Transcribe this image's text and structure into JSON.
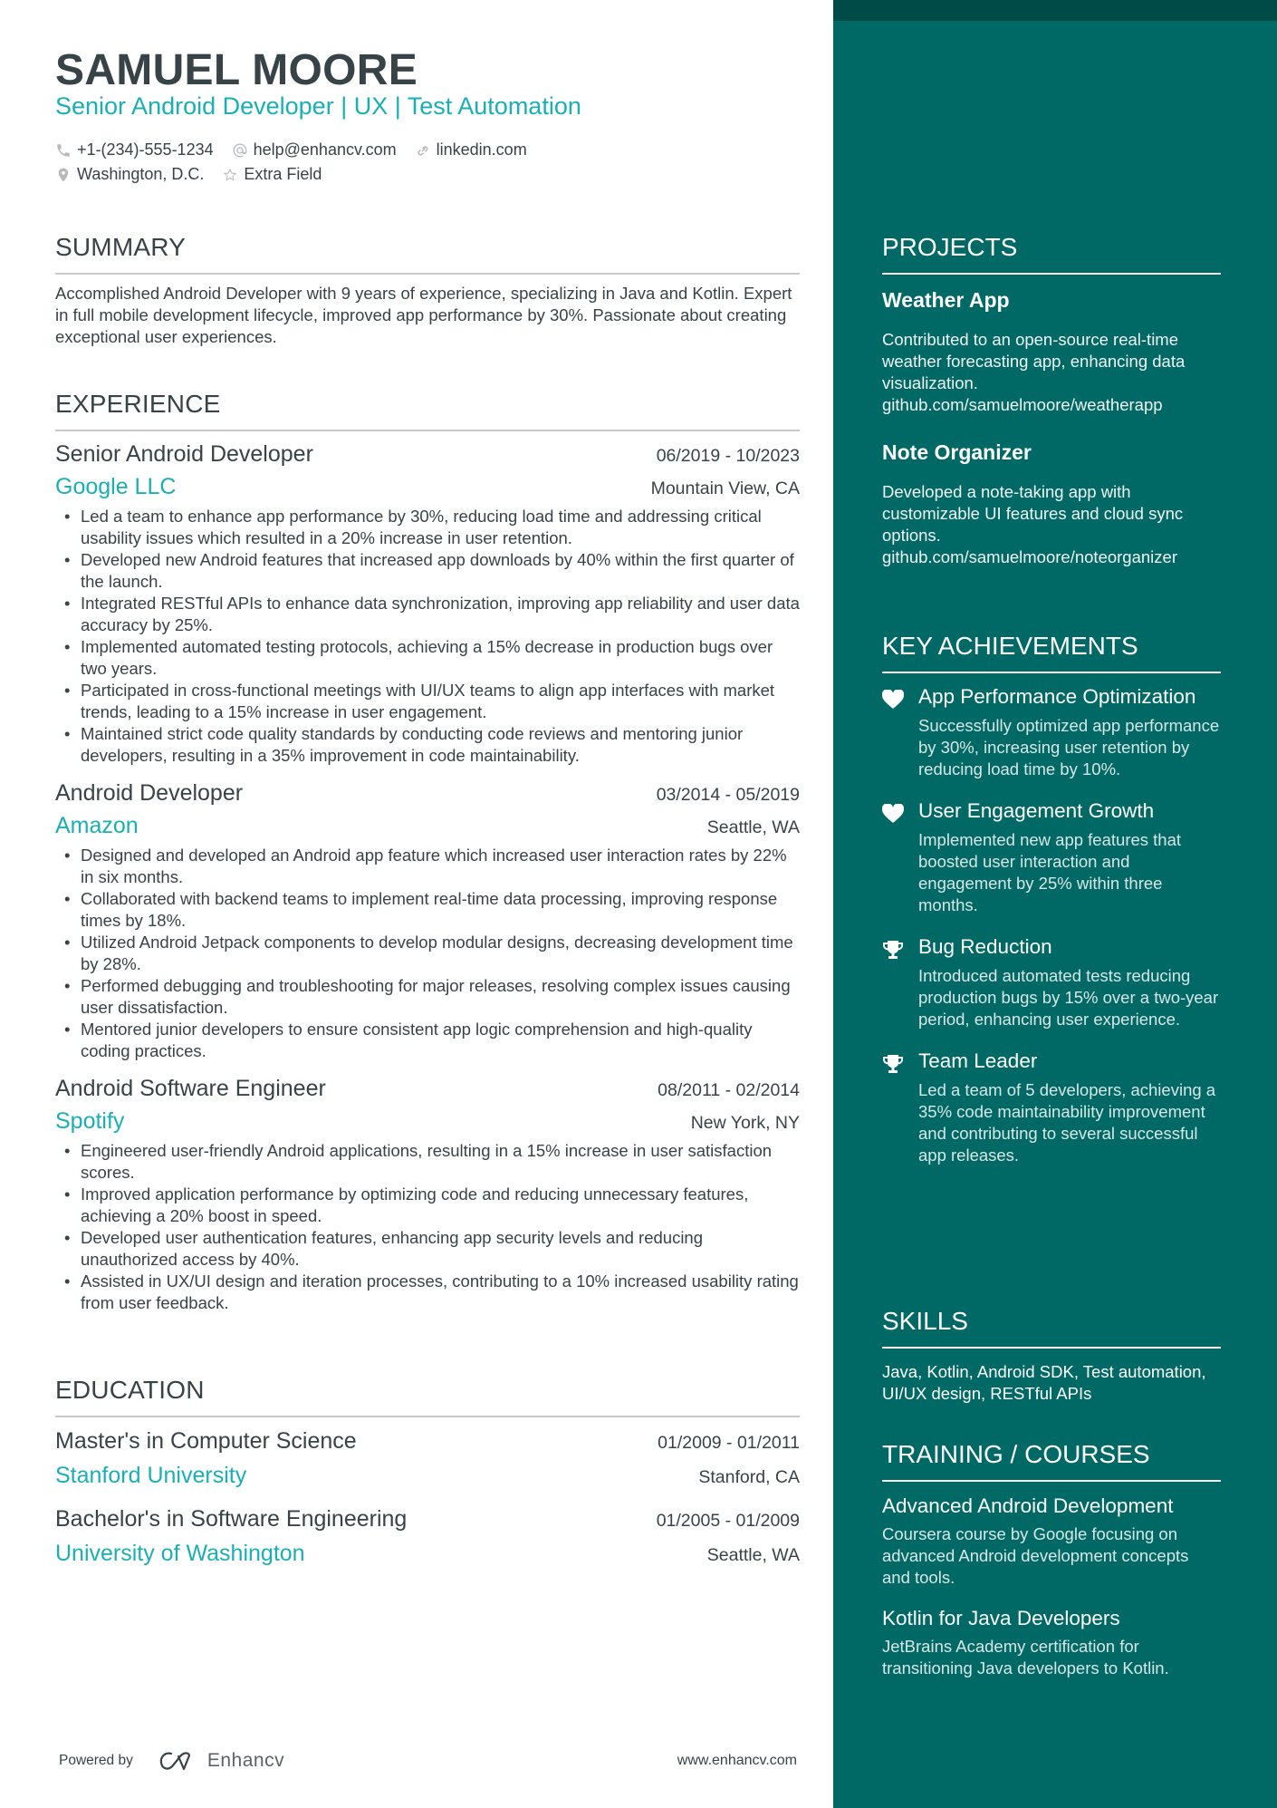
{
  "header": {
    "name": "SAMUEL MOORE",
    "headline": "Senior Android Developer | UX | Test Automation",
    "contacts": [
      {
        "icon": "phone-icon",
        "text": "+1-(234)-555-1234"
      },
      {
        "icon": "at-icon",
        "text": "help@enhancv.com"
      },
      {
        "icon": "link-icon",
        "text": "linkedin.com"
      },
      {
        "icon": "location-pin-icon",
        "text": "Washington, D.C."
      },
      {
        "icon": "star-icon",
        "text": "Extra Field"
      }
    ]
  },
  "summary": {
    "title": "SUMMARY",
    "text": "Accomplished Android Developer with 9 years of experience, specializing in Java and Kotlin. Expert in full mobile development lifecycle, improved app performance by 30%. Passionate about creating exceptional user experiences."
  },
  "experience": {
    "title": "EXPERIENCE",
    "jobs": [
      {
        "title": "Senior Android Developer",
        "dates": "06/2019 - 10/2023",
        "company": "Google LLC",
        "location": "Mountain View, CA",
        "bullets": [
          "Led a team to enhance app performance by 30%, reducing load time and addressing critical usability issues which resulted in a 20% increase in user retention.",
          "Developed new Android features that increased app downloads by 40% within the first quarter of the launch.",
          "Integrated RESTful APIs to enhance data synchronization, improving app reliability and user data accuracy by 25%.",
          "Implemented automated testing protocols, achieving a 15% decrease in production bugs over two years.",
          "Participated in cross-functional meetings with UI/UX teams to align app interfaces with market trends, leading to a 15% increase in user engagement.",
          "Maintained strict code quality standards by conducting code reviews and mentoring junior developers, resulting in a 35% improvement in code maintainability."
        ]
      },
      {
        "title": "Android Developer",
        "dates": "03/2014 - 05/2019",
        "company": "Amazon",
        "location": "Seattle, WA",
        "bullets": [
          "Designed and developed an Android app feature which increased user interaction rates by 22% in six months.",
          "Collaborated with backend teams to implement real-time data processing, improving response times by 18%.",
          "Utilized Android Jetpack components to develop modular designs, decreasing development time by 28%.",
          "Performed debugging and troubleshooting for major releases, resolving complex issues causing user dissatisfaction.",
          "Mentored junior developers to ensure consistent app logic comprehension and high-quality coding practices."
        ]
      },
      {
        "title": "Android Software Engineer",
        "dates": "08/2011 - 02/2014",
        "company": "Spotify",
        "location": "New York, NY",
        "bullets": [
          "Engineered user-friendly Android applications, resulting in a 15% increase in user satisfaction scores.",
          "Improved application performance by optimizing code and reducing unnecessary features, achieving a 20% boost in speed.",
          "Developed user authentication features, enhancing app security levels and reducing unauthorized access by 40%.",
          "Assisted in UX/UI design and iteration processes, contributing to a 10% increased usability rating from user feedback."
        ]
      }
    ]
  },
  "education": {
    "title": "EDUCATION",
    "items": [
      {
        "degree": "Master's in Computer Science",
        "dates": "01/2009 - 01/2011",
        "school": "Stanford University",
        "location": "Stanford, CA"
      },
      {
        "degree": "Bachelor's in Software Engineering",
        "dates": "01/2005 - 01/2009",
        "school": "University of Washington",
        "location": "Seattle, WA"
      }
    ]
  },
  "footer": {
    "powered_by": "Powered by",
    "brand": "Enhancv",
    "site": "www.enhancv.com"
  },
  "projects": {
    "title": "PROJECTS",
    "items": [
      {
        "name": "Weather App",
        "description": "Contributed to an open-source real-time weather forecasting app, enhancing data visualization.",
        "link": "github.com/samuelmoore/weatherapp"
      },
      {
        "name": "Note Organizer",
        "description": "Developed a note-taking app with customizable UI features and cloud sync options.",
        "link": "github.com/samuelmoore/noteorganizer"
      }
    ]
  },
  "achievements": {
    "title": "KEY ACHIEVEMENTS",
    "items": [
      {
        "icon": "heart-icon",
        "title": "App Performance Optimization",
        "description": "Successfully optimized app performance by 30%, increasing user retention by reducing load time by 10%."
      },
      {
        "icon": "heart-icon",
        "title": "User Engagement Growth",
        "description": "Implemented new app features that boosted user interaction and engagement by 25% within three months."
      },
      {
        "icon": "trophy-icon",
        "title": "Bug Reduction",
        "description": "Introduced automated tests reducing production bugs by 15% over a two-year period, enhancing user experience."
      },
      {
        "icon": "trophy-icon",
        "title": "Team Leader",
        "description": "Led a team of 5 developers, achieving a 35% code maintainability improvement and contributing to several successful app releases."
      }
    ]
  },
  "skills": {
    "title": "SKILLS",
    "text": "Java, Kotlin, Android SDK, Test automation, UI/UX design, RESTful APIs"
  },
  "training": {
    "title": "TRAINING / COURSES",
    "items": [
      {
        "title": "Advanced Android Development",
        "description": "Coursera course by Google focusing on advanced Android development concepts and tools."
      },
      {
        "title": "Kotlin for Java Developers",
        "description": "JetBrains Academy certification for transitioning Java developers to Kotlin."
      }
    ]
  },
  "colors": {
    "accent": "#1ab0b3",
    "text": "#384347",
    "sidebar": "#006966",
    "sidebar_band": "#004a48"
  }
}
